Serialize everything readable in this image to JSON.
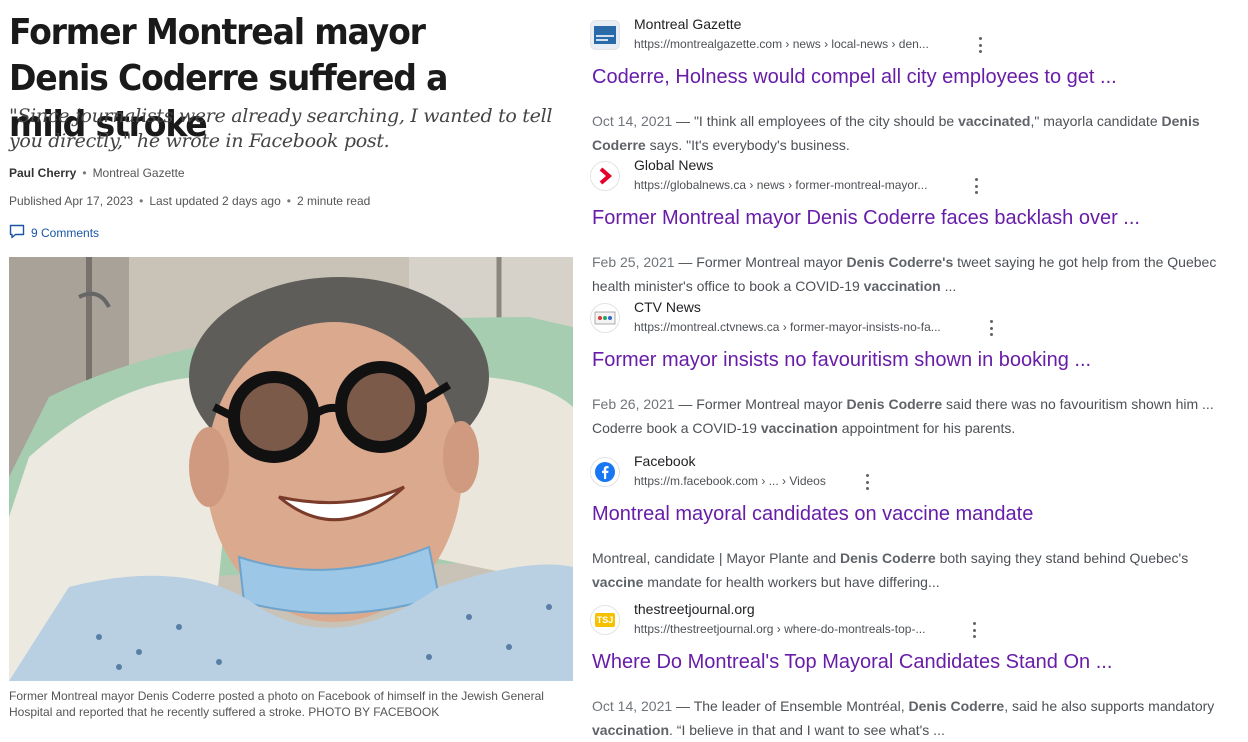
{
  "article": {
    "headline": "Former Montreal mayor Denis Coderre suffered a mild stroke",
    "deck": "\"Since journalists were already searching, I wanted to tell you directly,\" he wrote in Facebook post.",
    "author": "Paul Cherry",
    "outlet": "Montreal Gazette",
    "published": "Published Apr 17, 2023",
    "updated": "Last updated 2 days ago",
    "read_time": "2 minute read",
    "comments": "9 Comments",
    "caption": "Former Montreal mayor Denis Coderre posted a photo on Facebook of himself in the Jewish General Hospital and reported that he recently suffered a stroke. PHOTO BY FACEBOOK"
  },
  "results": [
    {
      "site": "Montreal Gazette",
      "url": "https://montrealgazette.com › news › local-news › den...",
      "favicon": "montreal-gazette-logo",
      "title": "Coderre, Holness would compel all city employees to get ...",
      "date": "Oct 14, 2021",
      "snippet": [
        {
          "t": " — \"I think all employees of the city should be "
        },
        {
          "t": "vaccinated",
          "b": true
        },
        {
          "t": ",\" mayorla candidate "
        },
        {
          "t": "Denis Coderre",
          "b": true
        },
        {
          "t": " says. \"It's everybody's business."
        }
      ]
    },
    {
      "site": "Global News",
      "url": "https://globalnews.ca › news › former-montreal-mayor...",
      "favicon": "global-news-logo",
      "title": "Former Montreal mayor Denis Coderre faces backlash over ...",
      "date": "Feb 25, 2021",
      "snippet": [
        {
          "t": " — Former Montreal mayor "
        },
        {
          "t": "Denis Coderre's",
          "b": true
        },
        {
          "t": " tweet saying he got help from the Quebec health minister's office to book a COVID-19 "
        },
        {
          "t": "vaccination",
          "b": true
        },
        {
          "t": " ..."
        }
      ]
    },
    {
      "site": "CTV News",
      "url": "https://montreal.ctvnews.ca › former-mayor-insists-no-fa...",
      "favicon": "ctv-news-logo",
      "title": "Former mayor insists no favouritism shown in booking ...",
      "date": "Feb 26, 2021",
      "snippet": [
        {
          "t": " — Former Montreal mayor "
        },
        {
          "t": "Denis Coderre",
          "b": true
        },
        {
          "t": " said there was no favouritism shown him ... Coderre book a COVID-19 "
        },
        {
          "t": "vaccination",
          "b": true
        },
        {
          "t": " appointment for his parents."
        }
      ]
    },
    {
      "site": "Facebook",
      "url": "https://m.facebook.com › ... › Videos",
      "favicon": "facebook-logo",
      "title": "Montreal mayoral candidates on vaccine mandate",
      "date": "",
      "snippet": [
        {
          "t": "Montreal, candidate | Mayor Plante and "
        },
        {
          "t": "Denis Coderre",
          "b": true
        },
        {
          "t": " both saying they stand behind Quebec's "
        },
        {
          "t": "vaccine",
          "b": true
        },
        {
          "t": " mandate for health workers but have differing..."
        }
      ]
    },
    {
      "site": "thestreetjournal.org",
      "url": "https://thestreetjournal.org › where-do-montreals-top-...",
      "favicon": "tsj-logo",
      "favicon_text": "TSJ",
      "title": "Where Do Montreal's Top Mayoral Candidates Stand On ...",
      "date": "Oct 14, 2021",
      "snippet": [
        {
          "t": " — The leader of Ensemble Montréal, "
        },
        {
          "t": "Denis Coderre",
          "b": true
        },
        {
          "t": ", said he also supports mandatory "
        },
        {
          "t": "vaccination",
          "b": true
        },
        {
          "t": ". “I believe in that and I want to see what's ..."
        }
      ]
    }
  ],
  "colors": {
    "link_visited": "#681da8",
    "comments_blue": "#1a55a5",
    "global_red": "#e4002b",
    "facebook_blue": "#1877f2",
    "tsj_yellow": "#f6c200"
  }
}
